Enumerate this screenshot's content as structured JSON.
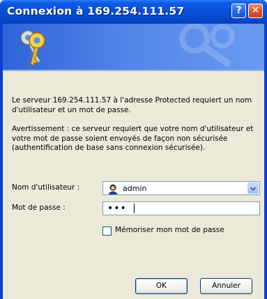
{
  "window": {
    "title": "Connexion à 169.254.111.57",
    "help_glyph": "?",
    "close_glyph": "✕"
  },
  "banner": {
    "icon": "keys-icon"
  },
  "message": {
    "line1": "Le serveur 169.254.111.57 à l'adresse Protected requiert un nom d'utilisateur et un mot de passe.",
    "warning": "Avertissement : ce serveur requiert que votre nom d'utilisateur et votre mot de passe soient envoyés de façon non sécurisée (authentification de base sans connexion sécurisée)."
  },
  "form": {
    "username_label": "Nom d'utilisateur :",
    "username_value": "admin",
    "password_label": "Mot de passe :",
    "password_value": "•••",
    "remember_label": "Mémoriser mon mot de passe",
    "remember_checked": false
  },
  "buttons": {
    "ok": "OK",
    "cancel": "Annuler"
  },
  "colors": {
    "titlebar": "#0651d9",
    "banner": "#4f84e8",
    "dialog_bg": "#ece9d8"
  }
}
